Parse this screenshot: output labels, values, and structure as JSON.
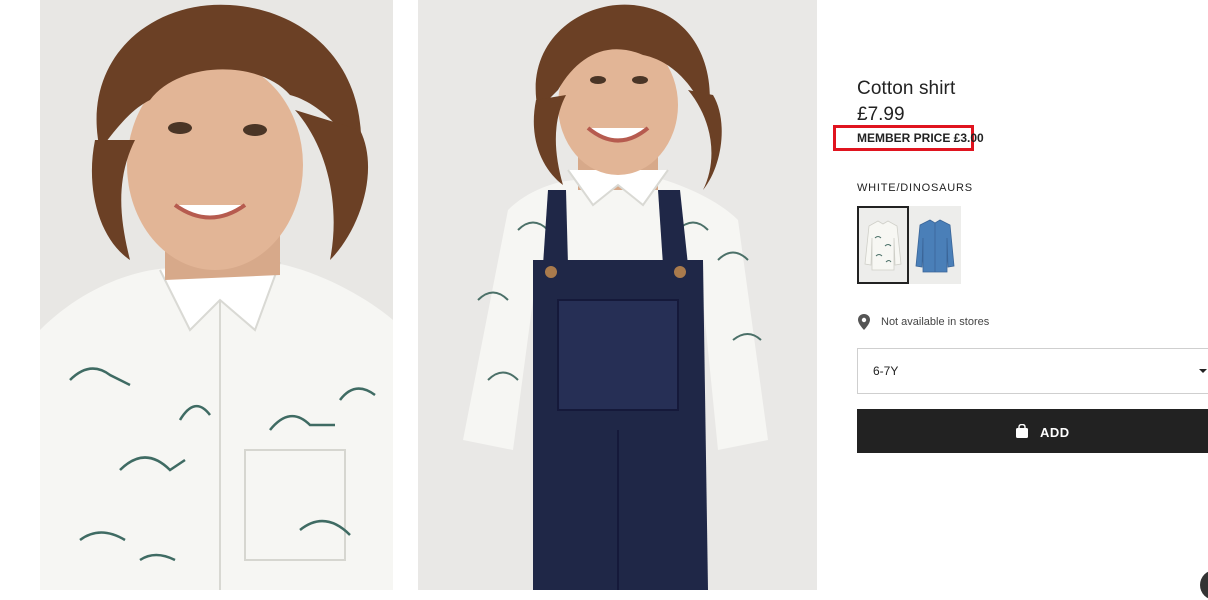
{
  "product": {
    "title": "Cotton shirt",
    "price": "£7.99",
    "member_price": "MEMBER PRICE £3.00",
    "color_name": "WHITE/DINOSAURS",
    "store_availability": "Not available in stores",
    "size_selected": "6-7Y",
    "add_label": "ADD"
  },
  "colors": {
    "highlight_box": "#e0141f",
    "button_bg": "#222222",
    "swatch_white": "#f4f4f0",
    "swatch_denim": "#4a7fb8",
    "overalls_navy": "#1f2747"
  },
  "icons": {
    "location": "location-pin-icon",
    "select": "chevron-down-icon",
    "bag": "shopping-bag-icon"
  }
}
